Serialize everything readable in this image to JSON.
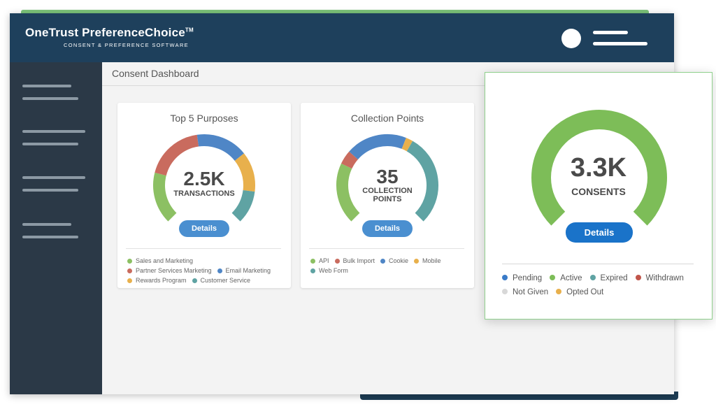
{
  "header": {
    "brand": "OneTrust PreferenceChoice",
    "trademark": "TM",
    "tagline": "CONSENT & PREFERENCE SOFTWARE"
  },
  "page": {
    "title": "Consent Dashboard"
  },
  "cards": [
    {
      "title": "Top 5 Purposes",
      "value": "2.5K",
      "label": "TRANSACTIONS",
      "button": "Details",
      "segments": [
        {
          "name": "Sales and Marketing",
          "color": "#8cc063",
          "share": 0.22
        },
        {
          "name": "Partner Services Marketing",
          "color": "#c96b5e",
          "share": 0.25
        },
        {
          "name": "Email Marketing",
          "color": "#4f86c6",
          "share": 0.22
        },
        {
          "name": "Rewards Program",
          "color": "#e8b04c",
          "share": 0.17
        },
        {
          "name": "Customer Service",
          "color": "#5fa3a3",
          "share": 0.14
        }
      ]
    },
    {
      "title": "Collection Points",
      "value": "35",
      "label": "COLLECTION POINTS",
      "button": "Details",
      "segments": [
        {
          "name": "API",
          "color": "#8cc063",
          "share": 0.26
        },
        {
          "name": "Bulk Import",
          "color": "#c96b5e",
          "share": 0.06
        },
        {
          "name": "Cookie",
          "color": "#4f86c6",
          "share": 0.26
        },
        {
          "name": "Mobile",
          "color": "#e8b04c",
          "share": 0.03
        },
        {
          "name": "Web Form",
          "color": "#5fa3a3",
          "share": 0.39
        }
      ]
    }
  ],
  "popup": {
    "value": "3.3K",
    "label": "CONSENTS",
    "button": "Details",
    "legend": [
      {
        "name": "Pending",
        "color": "#3a7bc8"
      },
      {
        "name": "Active",
        "color": "#7dbd58"
      },
      {
        "name": "Expired",
        "color": "#5fa3a3"
      },
      {
        "name": "Withdrawn",
        "color": "#c1554a"
      },
      {
        "name": "Not Given",
        "color": "#d8d8d8"
      },
      {
        "name": "Opted Out",
        "color": "#e8b04c"
      }
    ],
    "gauge_color": "#7dbd58"
  }
}
